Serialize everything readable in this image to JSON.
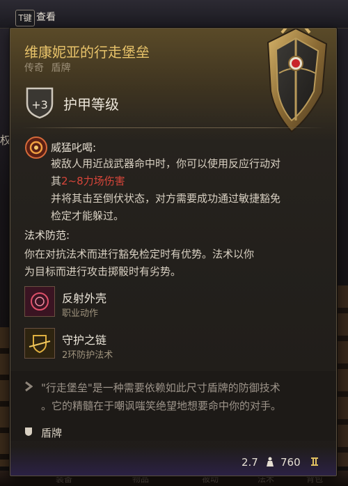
{
  "background": {
    "key_badge": "T键",
    "view_button": "查看",
    "left_label": "权",
    "bottom_tabs": [
      "装备",
      "物品",
      "被动",
      "法术",
      "背包"
    ]
  },
  "item": {
    "name": "维康妮亚的行走堡垒",
    "rarity": "传奇",
    "category": "盾牌",
    "armour_class_bonus": "+3",
    "armour_class_label": "护甲等级"
  },
  "passive": {
    "title": "威猛叱喝:",
    "line1": "被敌人用近战武器命中时，你可以使用反应行动对",
    "line2_prefix": "其",
    "line2_damage": "2~8力场伤害",
    "line3": "并将其击至倒伏状态，对方需要成功通过敏捷豁免",
    "line4": "检定才能躲过。"
  },
  "spell_ward": {
    "title": "法术防范:",
    "line1": "你在对抗法术而进行豁免检定时有优势。法术以你",
    "line2": "为目标而进行攻击掷骰时有劣势。"
  },
  "abilities": [
    {
      "name": "反射外壳",
      "type": "职业动作",
      "icon": "reflect-shell-icon"
    },
    {
      "name": "守护之链",
      "type": "2环防护法术",
      "icon": "warding-bond-icon"
    }
  ],
  "flavor": {
    "line1": "\"行走堡垒\"是一种需要依赖如此尺寸盾牌的防御技术",
    "line2": "。它的精髓在于嘲讽嗤笑绝望地想要命中你的对手。"
  },
  "tag": "盾牌",
  "footer": {
    "weight": "2.7",
    "price": "760"
  },
  "colors": {
    "item_name": "#e8c36a",
    "damage_text": "#d9463a",
    "flavor_text": "#9d948a",
    "footer_tint": "#2b2144"
  }
}
